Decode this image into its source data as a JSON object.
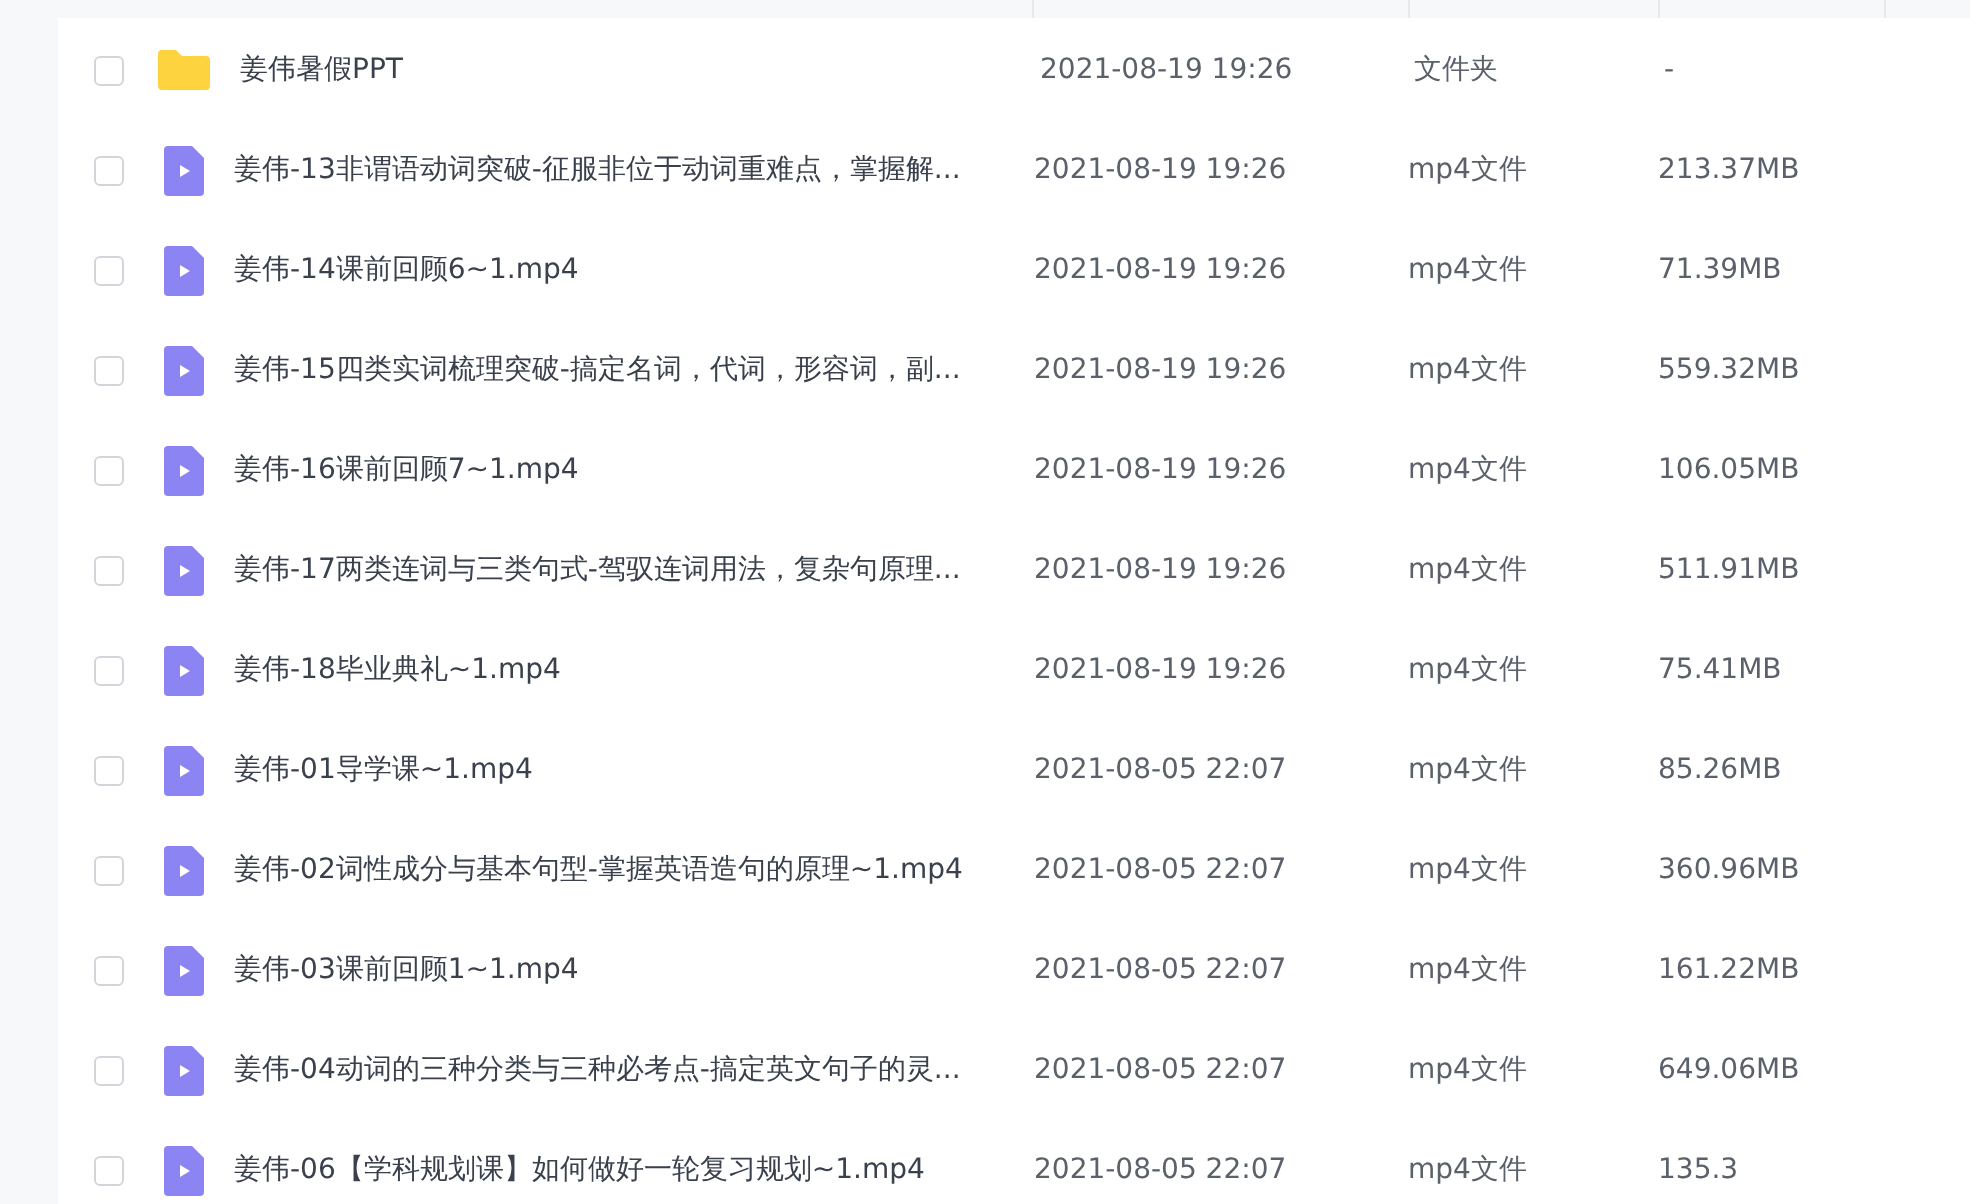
{
  "files": [
    {
      "kind": "folder",
      "checked": false,
      "name": "姜伟暑假PPT",
      "modified": "2021-08-19 19:26",
      "type": "文件夹",
      "size": "-"
    },
    {
      "kind": "video",
      "checked": false,
      "name": "姜伟-13非谓语动词突破-征服非位于动词重难点，掌握解...",
      "modified": "2021-08-19 19:26",
      "type": "mp4文件",
      "size": "213.37MB"
    },
    {
      "kind": "video",
      "checked": false,
      "name": "姜伟-14课前回顾6~1.mp4",
      "modified": "2021-08-19 19:26",
      "type": "mp4文件",
      "size": "71.39MB"
    },
    {
      "kind": "video",
      "checked": false,
      "name": "姜伟-15四类实词梳理突破-搞定名词，代词，形容词，副...",
      "modified": "2021-08-19 19:26",
      "type": "mp4文件",
      "size": "559.32MB"
    },
    {
      "kind": "video",
      "checked": false,
      "name": "姜伟-16课前回顾7~1.mp4",
      "modified": "2021-08-19 19:26",
      "type": "mp4文件",
      "size": "106.05MB"
    },
    {
      "kind": "video",
      "checked": false,
      "name": "姜伟-17两类连词与三类句式-驾驭连词用法，复杂句原理...",
      "modified": "2021-08-19 19:26",
      "type": "mp4文件",
      "size": "511.91MB"
    },
    {
      "kind": "video",
      "checked": false,
      "name": "姜伟-18毕业典礼~1.mp4",
      "modified": "2021-08-19 19:26",
      "type": "mp4文件",
      "size": "75.41MB"
    },
    {
      "kind": "video",
      "checked": false,
      "name": "姜伟-01导学课~1.mp4",
      "modified": "2021-08-05 22:07",
      "type": "mp4文件",
      "size": "85.26MB"
    },
    {
      "kind": "video",
      "checked": false,
      "name": "姜伟-02词性成分与基本句型-掌握英语造句的原理~1.mp4",
      "modified": "2021-08-05 22:07",
      "type": "mp4文件",
      "size": "360.96MB"
    },
    {
      "kind": "video",
      "checked": false,
      "name": "姜伟-03课前回顾1~1.mp4",
      "modified": "2021-08-05 22:07",
      "type": "mp4文件",
      "size": "161.22MB"
    },
    {
      "kind": "video",
      "checked": false,
      "name": "姜伟-04动词的三种分类与三种必考点-搞定英文句子的灵...",
      "modified": "2021-08-05 22:07",
      "type": "mp4文件",
      "size": "649.06MB"
    },
    {
      "kind": "video",
      "checked": false,
      "name": "姜伟-06【学科规划课】如何做好一轮复习规划~1.mp4",
      "modified": "2021-08-05 22:07",
      "type": "mp4文件",
      "size": "135.3"
    }
  ]
}
